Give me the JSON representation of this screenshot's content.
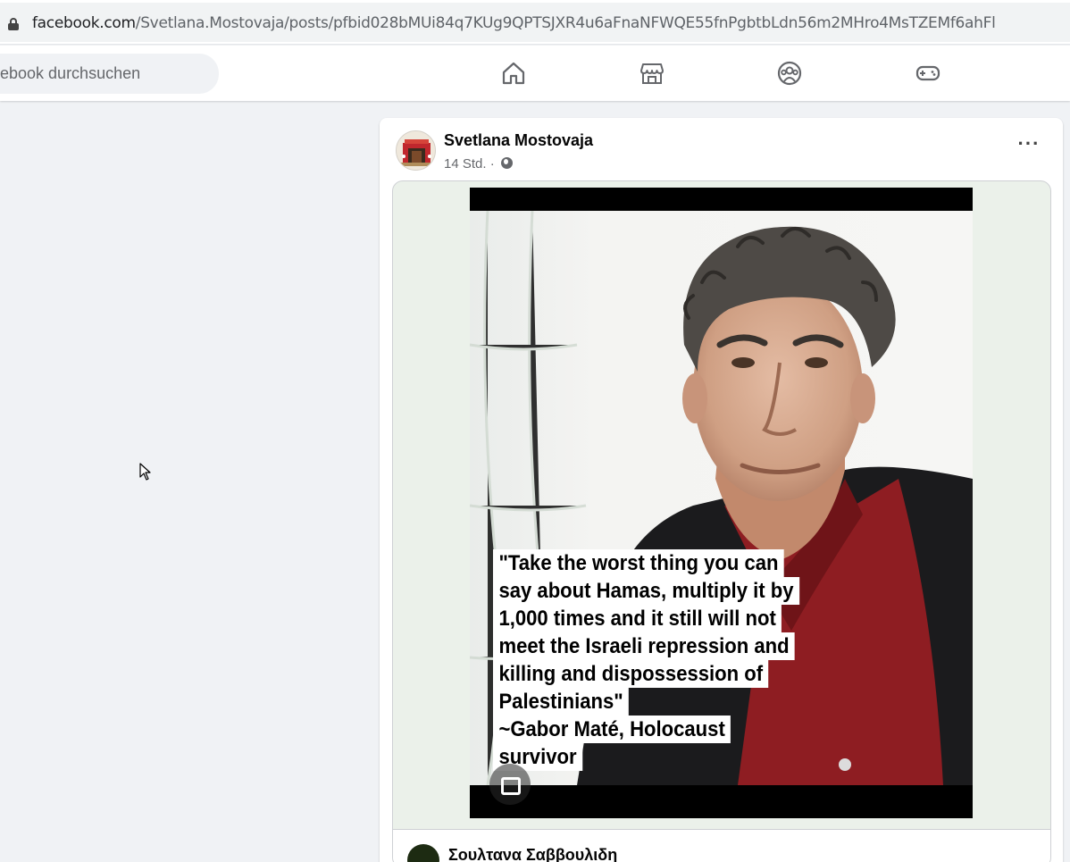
{
  "browser": {
    "url_host": "facebook.com",
    "url_path": "/Svetlana.Mostovaja/posts/pfbid028bMUi84q7KUg9QPTSJXR4u6aFnaNFWQE55fnPgbtbLdn56m2MHro4MsTZEMf6ahFl"
  },
  "fbnav": {
    "search_placeholder": "ebook durchsuchen",
    "icons": [
      "home-icon",
      "marketplace-icon",
      "groups-icon",
      "gaming-icon"
    ]
  },
  "post": {
    "author": "Svetlana Mostovaja",
    "timestamp": "14 Std. ·",
    "privacy_icon": "globe-icon",
    "more_label": "···",
    "image_quote_lines": [
      "\"Take the worst thing you can",
      "say about Hamas, multiply it by",
      "1,000 times and it still will not",
      "meet the Israeli repression and",
      "killing and dispossession of",
      "Palestinians\"",
      "~Gabor Maté, Holocaust",
      "survivor"
    ],
    "shared_from_author": "Σουλτανα Σαββουλιδη"
  },
  "colors": {
    "page_bg": "#f0f2f5",
    "card_bg": "#ffffff",
    "secondary_text": "#65676b",
    "shirt_red": "#8e1d22"
  }
}
